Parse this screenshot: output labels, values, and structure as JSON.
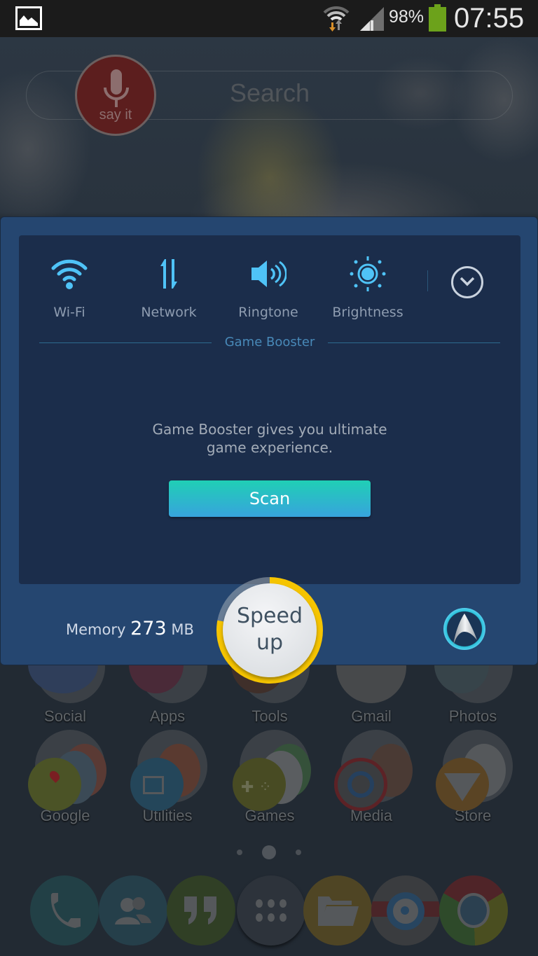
{
  "status_bar": {
    "notification_icon": "gallery-image-icon",
    "wifi_icon": "wifi-data-activity-icon",
    "signal_icon": "cell-signal-icon",
    "battery_percent": "98%",
    "battery_icon": "battery-icon",
    "time": "07:55",
    "colors": {
      "battery": "#6ca21b",
      "wifi_down_arrow": "#d9902a"
    }
  },
  "home": {
    "search": {
      "placeholder": "Search",
      "mic_label": "say it"
    },
    "row1": [
      {
        "label": "Social"
      },
      {
        "label": "Apps"
      },
      {
        "label": "Tools"
      },
      {
        "label": "Gmail"
      },
      {
        "label": "Photos"
      }
    ],
    "row2": [
      {
        "label": "Google"
      },
      {
        "label": "Utilities"
      },
      {
        "label": "Games"
      },
      {
        "label": "Media"
      },
      {
        "label": "Store"
      }
    ],
    "page_indicator": {
      "pages": 3,
      "current": 2
    },
    "dock": [
      {
        "name": "phone",
        "icon": "phone-icon"
      },
      {
        "name": "contacts",
        "icon": "contacts-icon"
      },
      {
        "name": "hangouts",
        "icon": "quote-icon"
      },
      {
        "name": "app-drawer",
        "icon": "apps-grid-icon"
      },
      {
        "name": "files",
        "icon": "folder-icon"
      },
      {
        "name": "camera",
        "icon": "camera-icon"
      },
      {
        "name": "chrome",
        "icon": "chrome-icon"
      }
    ]
  },
  "panel": {
    "quick_settings": [
      {
        "label": "Wi-Fi",
        "icon": "wifi-icon"
      },
      {
        "label": "Network",
        "icon": "network-arrows-icon"
      },
      {
        "label": "Ringtone",
        "icon": "speaker-icon"
      },
      {
        "label": "Brightness",
        "icon": "sun-icon"
      }
    ],
    "expand_icon": "chevron-down-circle-icon",
    "section_title": "Game Booster",
    "description_line1": "Game Booster gives you ultimate",
    "description_line2": "game experience.",
    "scan_label": "Scan",
    "memory_label": "Memory",
    "memory_value": "273",
    "memory_unit": "MB",
    "speed_up_line1": "Speed",
    "speed_up_line2": "up",
    "memory_gauge_fraction": 0.78,
    "colors": {
      "accent": "#4fc3f7",
      "panel": "#254670",
      "inner": "#1b2d4b",
      "gauge": "#f5c400",
      "scan_top": "#20cfb5",
      "scan_bottom": "#37a4dd"
    }
  }
}
